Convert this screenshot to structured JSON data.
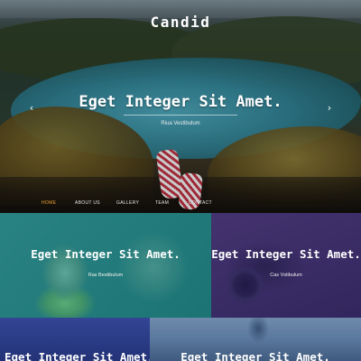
{
  "brand": "Candid",
  "hero": {
    "title": "Eget Integer Sit Amet.",
    "subtitle": "Riua Vestibulum",
    "prev_arrow": "‹",
    "next_arrow": "›"
  },
  "nav": {
    "items": [
      {
        "label": "HOME",
        "active": true
      },
      {
        "label": "ABOUT US",
        "active": false
      },
      {
        "label": "GALLERY",
        "active": false
      },
      {
        "label": "TEAM",
        "active": false
      },
      {
        "label": "CONTACT",
        "active": false
      }
    ]
  },
  "tiles": [
    {
      "title": "Eget Integer Sit Amet.",
      "subtitle": "Ras Bestibulum"
    },
    {
      "title": "Eget Integer Sit Amet.",
      "subtitle": "Cas Vstibulum"
    },
    {
      "title": "Eget Integer Sit Amet.",
      "subtitle": ""
    },
    {
      "title": "Eget Integer Sit Amet.",
      "subtitle": ""
    }
  ],
  "colors": {
    "accent_active": "#f0a030",
    "tile1_tint": "#009696",
    "tile2_tint": "#3c2882",
    "tile3_tint": "#283caa",
    "tile4_tint": "#285096"
  }
}
